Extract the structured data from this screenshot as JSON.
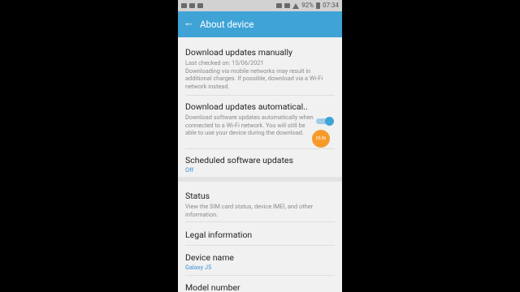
{
  "status_bar": {
    "battery": "92%",
    "time": "07:34",
    "icons": [
      "video-icon",
      "message-icon",
      "image-icon",
      "mute-icon",
      "alarm-icon",
      "signal-icon",
      "battery-icon"
    ]
  },
  "app_bar": {
    "back_icon": "←",
    "title": "About device"
  },
  "items": [
    {
      "title": "Download updates manually",
      "subtitle": "Last checked on: 15/06/2021\nDownloading via mobile networks may result in additional charges. If possible, download via a Wi-Fi network instead."
    },
    {
      "title": "Download updates automatical..",
      "subtitle": "Download software updates automatically when connected to a Wi-Fi network. You will still be able to use your device during the download.",
      "toggle_on": true
    },
    {
      "title": "Scheduled software updates",
      "value": "Off"
    },
    {
      "title": "Status",
      "subtitle": "View the SIM card status, device IMEI, and other information."
    },
    {
      "title": "Legal information"
    },
    {
      "title": "Device name",
      "value": "Galaxy J5"
    },
    {
      "title": "Model number"
    }
  ],
  "floating_badge": "05:56",
  "colors": {
    "accent": "#3fa3d6",
    "value_text": "#3a8fd0",
    "badge": "#f79a2a"
  }
}
